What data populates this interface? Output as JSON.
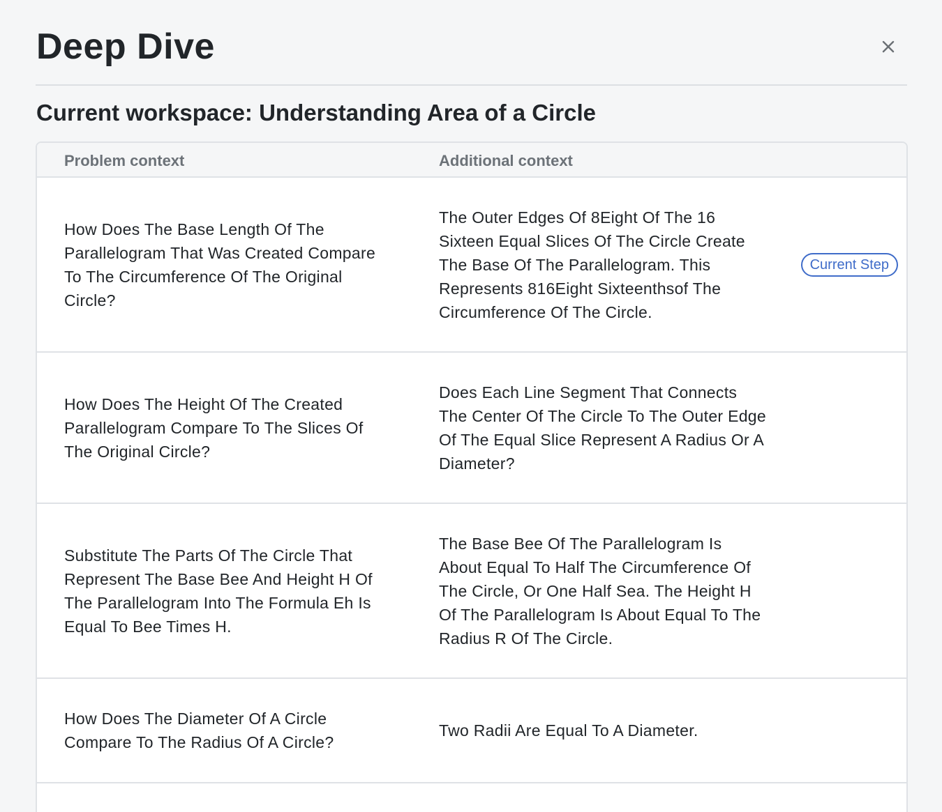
{
  "dialog": {
    "title": "Deep Dive",
    "close_icon": "close-icon",
    "workspace_heading": "Current workspace: Understanding Area of a Circle"
  },
  "table": {
    "columns": {
      "problem": "Problem context",
      "additional": "Additional context"
    },
    "rows": [
      {
        "problem": "How Does The Base Length Of The Parallelogram That Was Created Compare To The Circumference Of The Original Circle?",
        "additional": "The Outer Edges Of 8Eight Of The 16 Sixteen Equal Slices Of The Circle Create The Base Of The Parallelogram. This Represents 816Eight Sixteenthsof The Circumference Of The Circle.",
        "badge": "Current Step"
      },
      {
        "problem": "How Does The Height Of The Created Parallelogram Compare To The Slices Of The Original Circle?",
        "additional": "Does Each Line Segment That Connects The Center Of The Circle To The Outer Edge Of The Equal Slice Represent A Radius Or A Diameter?"
      },
      {
        "problem": "Substitute The Parts Of The Circle That Represent The Base Bee And Height H Of The Parallelogram Into The Formula Eh Is Equal To Bee Times H.",
        "additional": "The Base Bee Of The Parallelogram Is About Equal To Half The Circumference Of The Circle, Or One Half Sea. The Height H Of The Parallelogram Is About Equal To The Radius R Of The Circle."
      },
      {
        "problem": "How Does The Diameter Of A Circle Compare To The Radius Of A Circle?",
        "additional": "Two Radii Are Equal To A Diameter."
      }
    ]
  },
  "colors": {
    "background": "#f5f6f7",
    "accent": "#3f6cc9",
    "border": "#dfe2e6",
    "header_text": "#6c7278"
  }
}
